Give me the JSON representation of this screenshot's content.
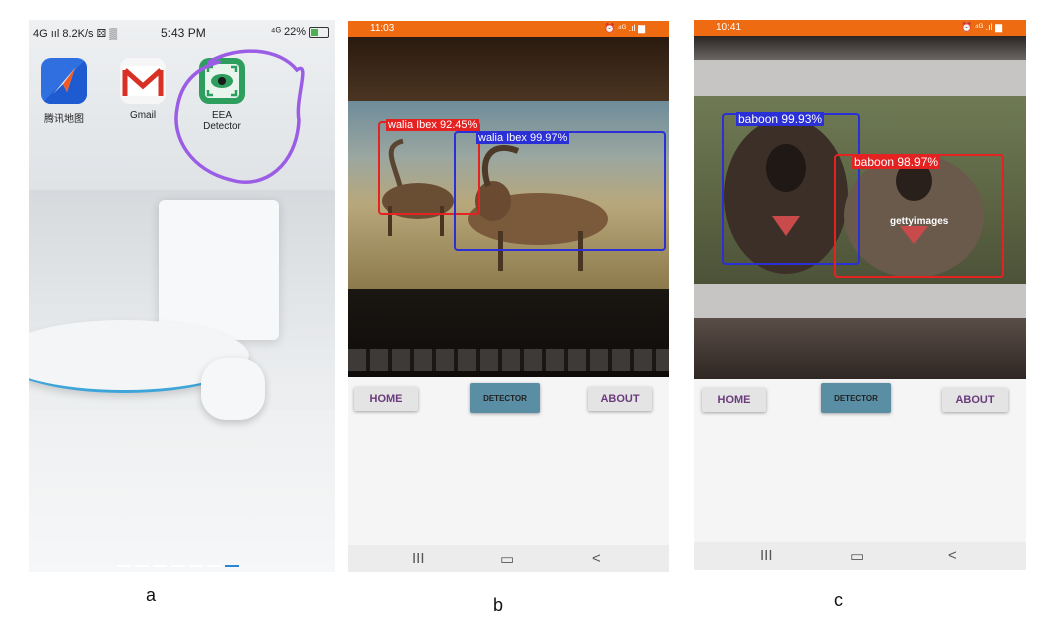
{
  "panel_a": {
    "status": {
      "left": "4G ııl 8.2K/s ⚄ ▒",
      "time": "5:43 PM",
      "right": "⁴ᴳ 22%"
    },
    "apps": [
      {
        "label": "腾讯地图",
        "icon": "map-navigation-icon",
        "color": "#2f6fe0"
      },
      {
        "label": "Gmail",
        "icon": "gmail-icon",
        "color": "#d93025"
      },
      {
        "label": "EEA Detector",
        "icon": "eye-detector-icon",
        "color": "#2e9e5f"
      }
    ],
    "highlight_color": "#9b5de5",
    "caption": "a"
  },
  "panel_b": {
    "status_time": "11:03",
    "status_right": "⏰ ⁴ᴳ .ıl ▆",
    "detections": [
      {
        "label": "walia Ibex 92.45%",
        "color": "#e52222"
      },
      {
        "label": "walia Ibex 99.97%",
        "color": "#2a2fd6"
      }
    ],
    "buttons": {
      "home": "HOME",
      "detector": "DETECTOR",
      "about": "ABOUT"
    },
    "sysnav": {
      "recents": "III",
      "home": "▭",
      "back": "<"
    },
    "caption": "b"
  },
  "panel_c": {
    "status_time": "10:41",
    "status_right": "⏰ ⁴ᴳ .ıl ▆",
    "detections": [
      {
        "label": "baboon 99.93%",
        "color": "#2a2fd6"
      },
      {
        "label": "baboon 98.97%",
        "color": "#e52222"
      }
    ],
    "watermark": "gettyimages",
    "buttons": {
      "home": "HOME",
      "detector": "DETECTOR",
      "about": "ABOUT"
    },
    "sysnav": {
      "recents": "III",
      "home": "▭",
      "back": "<"
    },
    "caption": "c"
  }
}
